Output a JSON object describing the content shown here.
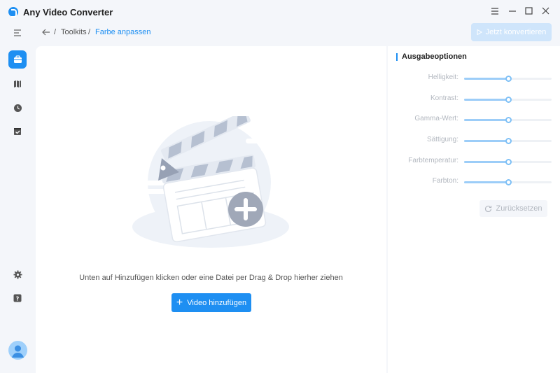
{
  "app": {
    "title": "Any Video Converter"
  },
  "window": {
    "menu_icon": "menu-icon",
    "minimize_icon": "minimize-icon",
    "maximize_icon": "maximize-icon",
    "close_icon": "close-icon"
  },
  "sidebar": {
    "items": [
      {
        "name": "collapse-icon",
        "active": false
      },
      {
        "name": "toolkit-icon",
        "active": true
      },
      {
        "name": "map-icon",
        "active": false
      },
      {
        "name": "history-icon",
        "active": false
      },
      {
        "name": "task-icon",
        "active": false
      },
      {
        "name": "settings-icon",
        "active": false
      },
      {
        "name": "help-icon",
        "active": false
      }
    ],
    "accent": "#1e8ff2"
  },
  "breadcrumb": {
    "sep": "/",
    "root": "Toolkits",
    "current": "Farbe anpassen"
  },
  "toolbar": {
    "convert_label": "Jetzt konvertieren"
  },
  "main": {
    "hint": "Unten auf Hinzufügen klicken oder eine Datei per Drag & Drop hierher ziehen",
    "add_label": "Video hinzufügen"
  },
  "options": {
    "title": "Ausgabeoptionen",
    "sliders": [
      {
        "label": "Helligkeit:",
        "value": 50
      },
      {
        "label": "Kontrast:",
        "value": 50
      },
      {
        "label": "Gamma-Wert:",
        "value": 50
      },
      {
        "label": "Sättigung:",
        "value": 50
      },
      {
        "label": "Farbtemperatur:",
        "value": 50
      },
      {
        "label": "Farbton:",
        "value": 50
      }
    ],
    "reset_label": "Zurücksetzen"
  }
}
